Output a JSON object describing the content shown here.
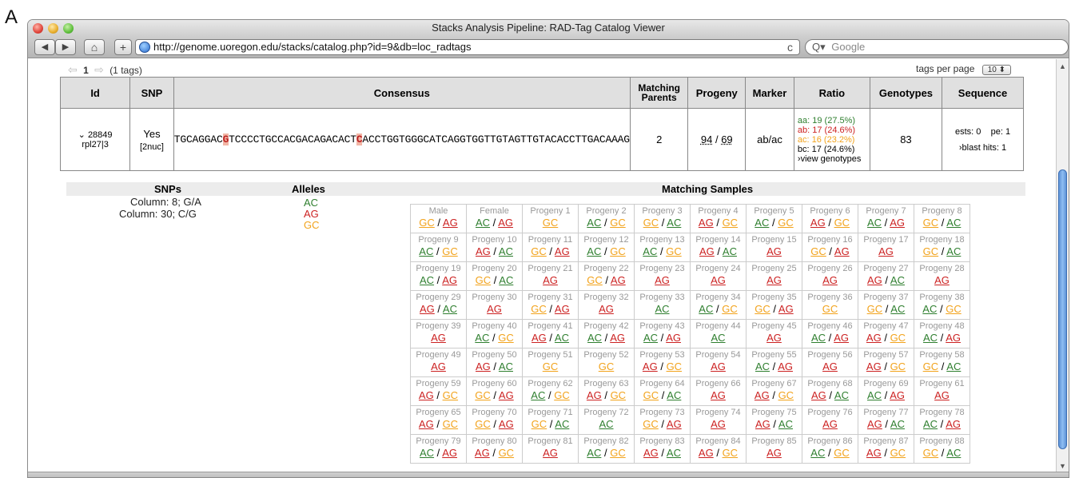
{
  "figure": {
    "panel_letter": "A"
  },
  "window": {
    "title": "Stacks Analysis Pipeline: RAD-Tag Catalog Viewer"
  },
  "toolbar": {
    "back_label": "◀",
    "forward_label": "▶",
    "home_label": "⌂",
    "add_label": "+",
    "url": "http://genome.uoregon.edu/stacks/catalog.php?id=9&db=loc_radtags",
    "reload_label": "c",
    "search_prefix": "Q▾",
    "search_placeholder": "Google"
  },
  "pager": {
    "page": "1",
    "count_label": "(1 tags)",
    "tags_per_page_label": "tags per page",
    "tags_per_page_value": "10 ⬍"
  },
  "table": {
    "headers": {
      "id": "Id",
      "snp": "SNP",
      "consensus": "Consensus",
      "parents_1": "Matching",
      "parents_2": "Parents",
      "progeny": "Progeny",
      "marker": "Marker",
      "ratio": "Ratio",
      "genotypes": "Genotypes",
      "sequence": "Sequence"
    },
    "row": {
      "id": "28849",
      "id_toggle": "⌄",
      "id_sub": "rpl27|3",
      "snp": "Yes",
      "snp_sub": "[2nuc]",
      "seq_1": "TGCAGGAC",
      "seq_snp1": "G",
      "seq_2": "TCCCCTGCCACGACAGACACT",
      "seq_snp2": "C",
      "seq_3": "ACCTGGTGGGCATCAGGTGGTTGTAGTTGTACACCTTGACAAAG",
      "parents": "2",
      "progeny_a": "94",
      "progeny_sep": " / ",
      "progeny_b": "69",
      "marker": "ab/ac",
      "ratio_aa": "aa: 19 (27.5%)",
      "ratio_ab": "ab: 17 (24.6%)",
      "ratio_ac": "ac: 16 (23.2%)",
      "ratio_bc": "bc: 17 (24.6%)",
      "ratio_view": "›view genotypes",
      "genotypes": "83",
      "seq_ests": "ests: 0",
      "seq_pe": "pe: 1",
      "seq_blast": "›blast hits: 1"
    }
  },
  "sub": {
    "headers": {
      "snps": "SNPs",
      "alleles": "Alleles",
      "samples": "Matching Samples"
    },
    "snps": [
      "Column: 8; G/A",
      "Column: 30; C/G"
    ],
    "alleles": [
      {
        "label": "AC",
        "color": "#2f7f2f"
      },
      {
        "label": "AG",
        "color": "#cc2222"
      },
      {
        "label": "GC",
        "color": "#f2a31c"
      }
    ]
  },
  "allele_colors": {
    "AC": "#2f7f2f",
    "AG": "#cc2222",
    "GC": "#f2a31c"
  },
  "samples": [
    [
      {
        "n": "Male",
        "g": [
          "GC",
          "AG"
        ]
      },
      {
        "n": "Female",
        "g": [
          "AC",
          "AG"
        ]
      },
      {
        "n": "Progeny 1",
        "g": [
          "GC"
        ]
      },
      {
        "n": "Progeny 2",
        "g": [
          "AC",
          "GC"
        ]
      },
      {
        "n": "Progeny 3",
        "g": [
          "GC",
          "AC"
        ]
      },
      {
        "n": "Progeny 4",
        "g": [
          "AG",
          "GC"
        ]
      },
      {
        "n": "Progeny 5",
        "g": [
          "AC",
          "GC"
        ]
      },
      {
        "n": "Progeny 6",
        "g": [
          "AG",
          "GC"
        ]
      },
      {
        "n": "Progeny 7",
        "g": [
          "AC",
          "AG"
        ]
      },
      {
        "n": "Progeny 8",
        "g": [
          "GC",
          "AC"
        ]
      }
    ],
    [
      {
        "n": "Progeny 9",
        "g": [
          "AC",
          "GC"
        ]
      },
      {
        "n": "Progeny 10",
        "g": [
          "AG",
          "AC"
        ]
      },
      {
        "n": "Progeny 11",
        "g": [
          "GC",
          "AG"
        ]
      },
      {
        "n": "Progeny 12",
        "g": [
          "AC",
          "GC"
        ]
      },
      {
        "n": "Progeny 13",
        "g": [
          "AC",
          "GC"
        ]
      },
      {
        "n": "Progeny 14",
        "g": [
          "AG",
          "AC"
        ]
      },
      {
        "n": "Progeny 15",
        "g": [
          "AG"
        ]
      },
      {
        "n": "Progeny 16",
        "g": [
          "GC",
          "AG"
        ]
      },
      {
        "n": "Progeny 17",
        "g": [
          "AG"
        ]
      },
      {
        "n": "Progeny 18",
        "g": [
          "GC",
          "AC"
        ]
      }
    ],
    [
      {
        "n": "Progeny 19",
        "g": [
          "AC",
          "AG"
        ]
      },
      {
        "n": "Progeny 20",
        "g": [
          "GC",
          "AC"
        ]
      },
      {
        "n": "Progeny 21",
        "g": [
          "AG"
        ]
      },
      {
        "n": "Progeny 22",
        "g": [
          "GC",
          "AG"
        ]
      },
      {
        "n": "Progeny 23",
        "g": [
          "AG"
        ]
      },
      {
        "n": "Progeny 24",
        "g": [
          "AG"
        ]
      },
      {
        "n": "Progeny 25",
        "g": [
          "AG"
        ]
      },
      {
        "n": "Progeny 26",
        "g": [
          "AG"
        ]
      },
      {
        "n": "Progeny 27",
        "g": [
          "AG",
          "AC"
        ]
      },
      {
        "n": "Progeny 28",
        "g": [
          "AG"
        ]
      }
    ],
    [
      {
        "n": "Progeny 29",
        "g": [
          "AG",
          "AC"
        ]
      },
      {
        "n": "Progeny 30",
        "g": [
          "AG"
        ]
      },
      {
        "n": "Progeny 31",
        "g": [
          "GC",
          "AG"
        ]
      },
      {
        "n": "Progeny 32",
        "g": [
          "AG"
        ]
      },
      {
        "n": "Progeny 33",
        "g": [
          "AC"
        ]
      },
      {
        "n": "Progeny 34",
        "g": [
          "AC",
          "GC"
        ]
      },
      {
        "n": "Progeny 35",
        "g": [
          "GC",
          "AG"
        ]
      },
      {
        "n": "Progeny 36",
        "g": [
          "GC"
        ]
      },
      {
        "n": "Progeny 37",
        "g": [
          "GC",
          "AC"
        ]
      },
      {
        "n": "Progeny 38",
        "g": [
          "AC",
          "GC"
        ]
      }
    ],
    [
      {
        "n": "Progeny 39",
        "g": [
          "AG"
        ]
      },
      {
        "n": "Progeny 40",
        "g": [
          "AC",
          "GC"
        ]
      },
      {
        "n": "Progeny 41",
        "g": [
          "AG",
          "AC"
        ]
      },
      {
        "n": "Progeny 42",
        "g": [
          "AC",
          "AG"
        ]
      },
      {
        "n": "Progeny 43",
        "g": [
          "AC",
          "AG"
        ]
      },
      {
        "n": "Progeny 44",
        "g": [
          "AC"
        ]
      },
      {
        "n": "Progeny 45",
        "g": [
          "AG"
        ]
      },
      {
        "n": "Progeny 46",
        "g": [
          "AC",
          "AG"
        ]
      },
      {
        "n": "Progeny 47",
        "g": [
          "AG",
          "GC"
        ]
      },
      {
        "n": "Progeny 48",
        "g": [
          "AC",
          "AG"
        ]
      }
    ],
    [
      {
        "n": "Progeny 49",
        "g": [
          "AG"
        ]
      },
      {
        "n": "Progeny 50",
        "g": [
          "AG",
          "AC"
        ]
      },
      {
        "n": "Progeny 51",
        "g": [
          "GC"
        ]
      },
      {
        "n": "Progeny 52",
        "g": [
          "GC"
        ]
      },
      {
        "n": "Progeny 53",
        "g": [
          "AG",
          "GC"
        ]
      },
      {
        "n": "Progeny 54",
        "g": [
          "AG"
        ]
      },
      {
        "n": "Progeny 55",
        "g": [
          "AC",
          "AG"
        ]
      },
      {
        "n": "Progeny 56",
        "g": [
          "AG"
        ]
      },
      {
        "n": "Progeny 57",
        "g": [
          "AG",
          "GC"
        ]
      },
      {
        "n": "Progeny 58",
        "g": [
          "GC",
          "AC"
        ]
      }
    ],
    [
      {
        "n": "Progeny 59",
        "g": [
          "AG",
          "GC"
        ]
      },
      {
        "n": "Progeny 60",
        "g": [
          "GC",
          "AG"
        ]
      },
      {
        "n": "Progeny 62",
        "g": [
          "AC",
          "GC"
        ]
      },
      {
        "n": "Progeny 63",
        "g": [
          "AG",
          "GC"
        ]
      },
      {
        "n": "Progeny 64",
        "g": [
          "GC",
          "AC"
        ]
      },
      {
        "n": "Progeny 66",
        "g": [
          "AG"
        ]
      },
      {
        "n": "Progeny 67",
        "g": [
          "AG",
          "GC"
        ]
      },
      {
        "n": "Progeny 68",
        "g": [
          "AG",
          "AC"
        ]
      },
      {
        "n": "Progeny 69",
        "g": [
          "AC",
          "AG"
        ]
      },
      {
        "n": "Progeny 61",
        "g": [
          "AG"
        ]
      }
    ],
    [
      {
        "n": "Progeny 65",
        "g": [
          "AG",
          "GC"
        ]
      },
      {
        "n": "Progeny 70",
        "g": [
          "GC",
          "AG"
        ]
      },
      {
        "n": "Progeny 71",
        "g": [
          "GC",
          "AC"
        ]
      },
      {
        "n": "Progeny 72",
        "g": [
          "AC"
        ]
      },
      {
        "n": "Progeny 73",
        "g": [
          "GC",
          "AG"
        ]
      },
      {
        "n": "Progeny 74",
        "g": [
          "AG"
        ]
      },
      {
        "n": "Progeny 75",
        "g": [
          "AG",
          "AC"
        ]
      },
      {
        "n": "Progeny 76",
        "g": [
          "AG"
        ]
      },
      {
        "n": "Progeny 77",
        "g": [
          "AG",
          "AC"
        ]
      },
      {
        "n": "Progeny 78",
        "g": [
          "AC",
          "AG"
        ]
      }
    ],
    [
      {
        "n": "Progeny 79",
        "g": [
          "AC",
          "AG"
        ]
      },
      {
        "n": "Progeny 80",
        "g": [
          "AG",
          "GC"
        ]
      },
      {
        "n": "Progeny 81",
        "g": [
          "AG"
        ]
      },
      {
        "n": "Progeny 82",
        "g": [
          "AC",
          "GC"
        ]
      },
      {
        "n": "Progeny 83",
        "g": [
          "AG",
          "AC"
        ]
      },
      {
        "n": "Progeny 84",
        "g": [
          "AG",
          "GC"
        ]
      },
      {
        "n": "Progeny 85",
        "g": [
          "AG"
        ]
      },
      {
        "n": "Progeny 86",
        "g": [
          "AC",
          "GC"
        ]
      },
      {
        "n": "Progeny 87",
        "g": [
          "AG",
          "GC"
        ]
      },
      {
        "n": "Progeny 88",
        "g": [
          "GC",
          "AC"
        ]
      }
    ]
  ]
}
